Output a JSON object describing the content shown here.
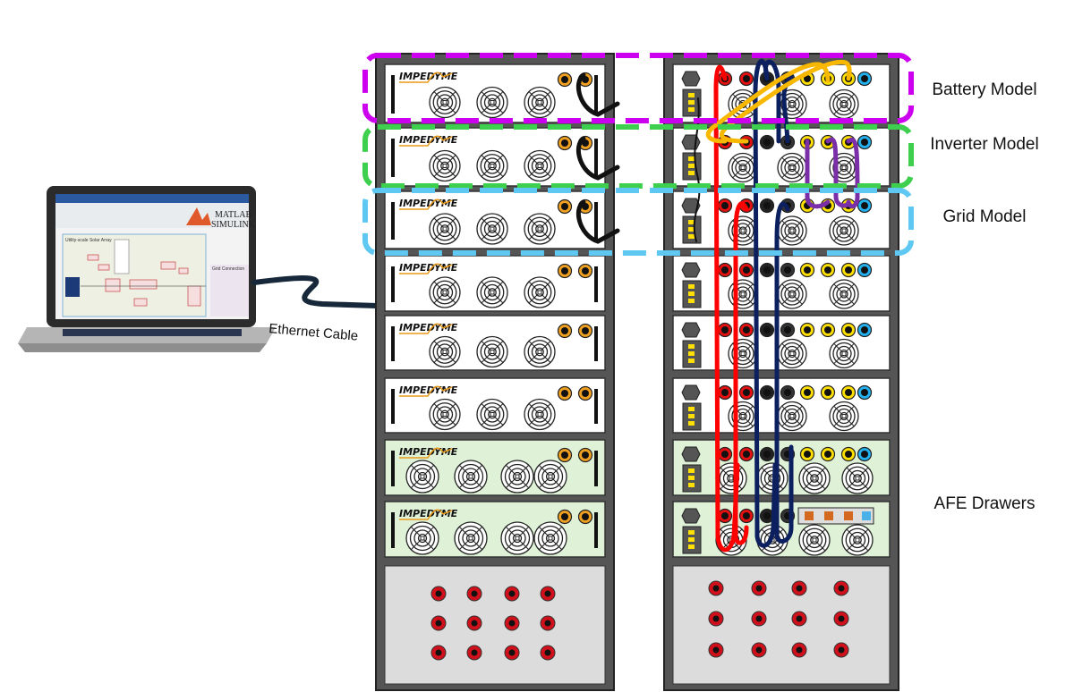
{
  "labels": {
    "battery_model": "Battery Model",
    "inverter_model": "Inverter Model",
    "grid_model": "Grid Model",
    "afe_drawers": "AFE Drawers",
    "ethernet_cable": "Ethernet Cable"
  },
  "laptop": {
    "brand_line1": "MATLAB",
    "brand_line2": "SIMULINK",
    "subsystem_1": "Utility-scale Solar Array",
    "subsystem_2": "Grid Connection"
  },
  "logo_text": "IMPEDYME",
  "colors": {
    "battery_box": "#cc00ee",
    "inverter_box": "#3ecf4f",
    "grid_box": "#5ec8f2",
    "rack_frame": "#555555",
    "afe_drawer_fill": "#dff2d8",
    "ethernet_cable": "#16283a"
  },
  "left_rack": {
    "white_drawers": 6,
    "afe_drawers": 2
  },
  "right_rack": {
    "white_drawers": 6,
    "afe_drawers": 2
  }
}
